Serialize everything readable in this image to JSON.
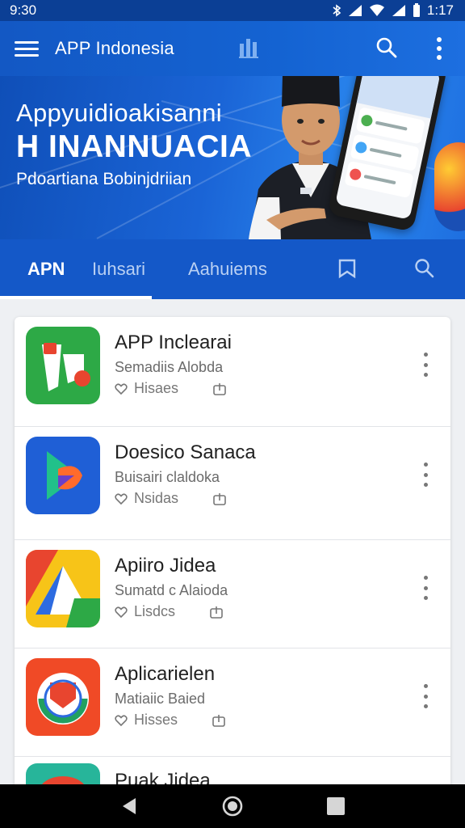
{
  "status": {
    "time": "9:30",
    "clock_right": "1:17"
  },
  "appbar": {
    "title": "APP Indonesia"
  },
  "banner": {
    "headline": "Appyuidioakisanni",
    "headline2": "H INANNUACIA",
    "subtitle": "Pdoartiana Bobinjdriian"
  },
  "tabs": [
    {
      "label": "APN"
    },
    {
      "label": "Iuhsari"
    },
    {
      "label": "Aahuiems"
    }
  ],
  "apps": [
    {
      "title": "APP Inclearai",
      "subtitle": "Semadiis Alobda",
      "meta": "Hisaes"
    },
    {
      "title": "Doesico Sanaca",
      "subtitle": "Buisairi claldoka",
      "meta": "Nsidas"
    },
    {
      "title": "Apiiro Jidea",
      "subtitle": "Sumatd c Alaioda",
      "meta": "Lisdcs"
    },
    {
      "title": "Aplicarielen",
      "subtitle": "Matiaiic Baied",
      "meta": "Hisses"
    },
    {
      "title": "Puak Jidea"
    }
  ],
  "colors": {
    "primary": "#1458c8",
    "status_bar": "#0b3f95",
    "nav_bar": "#000000"
  },
  "icons": [
    "menu-icon",
    "bar-chart-icon",
    "search-icon",
    "more-vert-icon",
    "bookmark-icon",
    "heart-icon",
    "share-icon",
    "back-icon",
    "home-icon",
    "recents-icon"
  ]
}
